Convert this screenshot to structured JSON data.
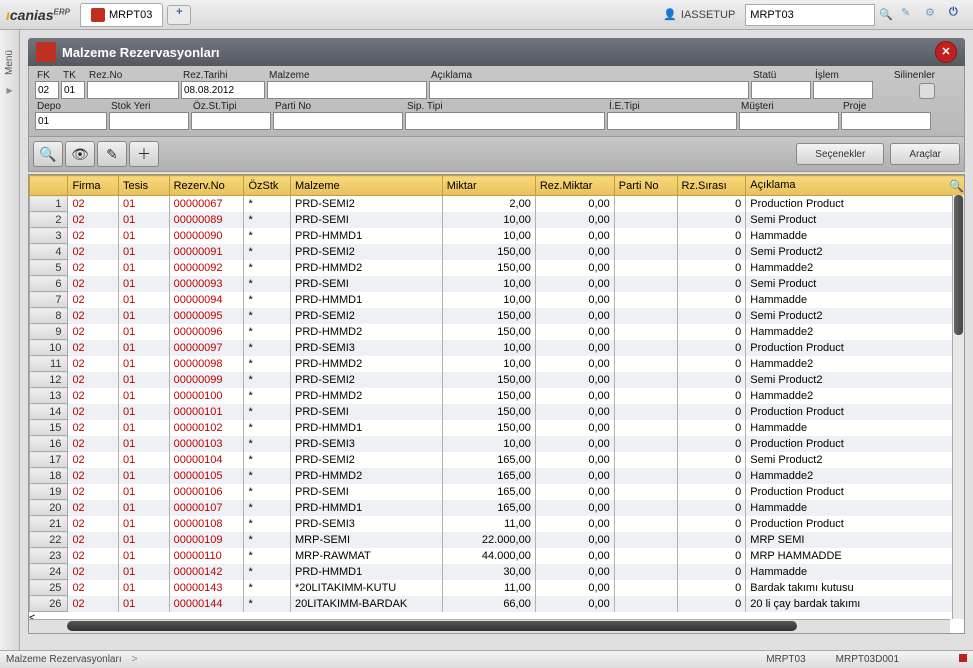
{
  "app": {
    "logo_primary": "canias",
    "logo_suffix": "ERP"
  },
  "topbar": {
    "tab_label": "MRPT03",
    "username": "IASSETUP",
    "search": {
      "value": "MRPT03"
    }
  },
  "sidepanel": {
    "menu": "Menü"
  },
  "window": {
    "title": "Malzeme Rezervasyonları"
  },
  "filters": {
    "row1": {
      "fk": {
        "label": "FK",
        "value": "02"
      },
      "tk": {
        "label": "TK",
        "value": "01"
      },
      "rezno": {
        "label": "Rez.No",
        "value": ""
      },
      "reztarihi": {
        "label": "Rez.Tarihi",
        "value": "08.08.2012"
      },
      "malzeme": {
        "label": "Malzeme",
        "value": ""
      },
      "aciklama": {
        "label": "Açıklama",
        "value": ""
      },
      "statu": {
        "label": "Statü",
        "value": ""
      },
      "islem": {
        "label": "İşlem",
        "value": ""
      },
      "silinenler": {
        "label": "Silinenler"
      }
    },
    "row2": {
      "depo": {
        "label": "Depo",
        "value": "01"
      },
      "stokyeri": {
        "label": "Stok Yeri",
        "value": ""
      },
      "ozsttipi": {
        "label": "Öz.St.Tipi",
        "value": ""
      },
      "partino": {
        "label": "Parti No",
        "value": ""
      },
      "siptipi": {
        "label": "Sip. Tipi",
        "value": ""
      },
      "ietipi": {
        "label": "İ.E.Tipi",
        "value": ""
      },
      "musteri": {
        "label": "Müşteri",
        "value": ""
      },
      "proje": {
        "label": "Proje",
        "value": ""
      }
    }
  },
  "toolbar": {
    "secenekler": "Seçenekler",
    "araclar": "Araçlar"
  },
  "table": {
    "headers": {
      "firma": "Firma",
      "tesis": "Tesis",
      "rezervno": "Rezerv.No",
      "ozstk": "ÖzStk",
      "malzeme": "Malzeme",
      "miktar": "Miktar",
      "rezmiktar": "Rez.Miktar",
      "partino": "Parti No",
      "rzsirasi": "Rz.Sırası",
      "aciklama": "Açıklama"
    },
    "rows": [
      {
        "n": "1",
        "firma": "02",
        "tesis": "01",
        "rez": "00000067",
        "oz": "*",
        "mal": "PRD-SEMI2",
        "mik": "2,00",
        "rm": "0,00",
        "pn": "",
        "rs": "0",
        "ac": "Production Product"
      },
      {
        "n": "2",
        "firma": "02",
        "tesis": "01",
        "rez": "00000089",
        "oz": "*",
        "mal": "PRD-SEMI",
        "mik": "10,00",
        "rm": "0,00",
        "pn": "",
        "rs": "0",
        "ac": "Semi Product"
      },
      {
        "n": "3",
        "firma": "02",
        "tesis": "01",
        "rez": "00000090",
        "oz": "*",
        "mal": "PRD-HMMD1",
        "mik": "10,00",
        "rm": "0,00",
        "pn": "",
        "rs": "0",
        "ac": "Hammadde"
      },
      {
        "n": "4",
        "firma": "02",
        "tesis": "01",
        "rez": "00000091",
        "oz": "*",
        "mal": "PRD-SEMI2",
        "mik": "150,00",
        "rm": "0,00",
        "pn": "",
        "rs": "0",
        "ac": "Semi Product2"
      },
      {
        "n": "5",
        "firma": "02",
        "tesis": "01",
        "rez": "00000092",
        "oz": "*",
        "mal": "PRD-HMMD2",
        "mik": "150,00",
        "rm": "0,00",
        "pn": "",
        "rs": "0",
        "ac": "Hammadde2"
      },
      {
        "n": "6",
        "firma": "02",
        "tesis": "01",
        "rez": "00000093",
        "oz": "*",
        "mal": "PRD-SEMI",
        "mik": "10,00",
        "rm": "0,00",
        "pn": "",
        "rs": "0",
        "ac": "Semi Product"
      },
      {
        "n": "7",
        "firma": "02",
        "tesis": "01",
        "rez": "00000094",
        "oz": "*",
        "mal": "PRD-HMMD1",
        "mik": "10,00",
        "rm": "0,00",
        "pn": "",
        "rs": "0",
        "ac": "Hammadde"
      },
      {
        "n": "8",
        "firma": "02",
        "tesis": "01",
        "rez": "00000095",
        "oz": "*",
        "mal": "PRD-SEMI2",
        "mik": "150,00",
        "rm": "0,00",
        "pn": "",
        "rs": "0",
        "ac": "Semi Product2"
      },
      {
        "n": "9",
        "firma": "02",
        "tesis": "01",
        "rez": "00000096",
        "oz": "*",
        "mal": "PRD-HMMD2",
        "mik": "150,00",
        "rm": "0,00",
        "pn": "",
        "rs": "0",
        "ac": "Hammadde2"
      },
      {
        "n": "10",
        "firma": "02",
        "tesis": "01",
        "rez": "00000097",
        "oz": "*",
        "mal": "PRD-SEMI3",
        "mik": "10,00",
        "rm": "0,00",
        "pn": "",
        "rs": "0",
        "ac": "Production Product"
      },
      {
        "n": "11",
        "firma": "02",
        "tesis": "01",
        "rez": "00000098",
        "oz": "*",
        "mal": "PRD-HMMD2",
        "mik": "10,00",
        "rm": "0,00",
        "pn": "",
        "rs": "0",
        "ac": "Hammadde2"
      },
      {
        "n": "12",
        "firma": "02",
        "tesis": "01",
        "rez": "00000099",
        "oz": "*",
        "mal": "PRD-SEMI2",
        "mik": "150,00",
        "rm": "0,00",
        "pn": "",
        "rs": "0",
        "ac": "Semi Product2"
      },
      {
        "n": "13",
        "firma": "02",
        "tesis": "01",
        "rez": "00000100",
        "oz": "*",
        "mal": "PRD-HMMD2",
        "mik": "150,00",
        "rm": "0,00",
        "pn": "",
        "rs": "0",
        "ac": "Hammadde2"
      },
      {
        "n": "14",
        "firma": "02",
        "tesis": "01",
        "rez": "00000101",
        "oz": "*",
        "mal": "PRD-SEMI",
        "mik": "150,00",
        "rm": "0,00",
        "pn": "",
        "rs": "0",
        "ac": "Production Product"
      },
      {
        "n": "15",
        "firma": "02",
        "tesis": "01",
        "rez": "00000102",
        "oz": "*",
        "mal": "PRD-HMMD1",
        "mik": "150,00",
        "rm": "0,00",
        "pn": "",
        "rs": "0",
        "ac": "Hammadde"
      },
      {
        "n": "16",
        "firma": "02",
        "tesis": "01",
        "rez": "00000103",
        "oz": "*",
        "mal": "PRD-SEMI3",
        "mik": "10,00",
        "rm": "0,00",
        "pn": "",
        "rs": "0",
        "ac": "Production Product"
      },
      {
        "n": "17",
        "firma": "02",
        "tesis": "01",
        "rez": "00000104",
        "oz": "*",
        "mal": "PRD-SEMI2",
        "mik": "165,00",
        "rm": "0,00",
        "pn": "",
        "rs": "0",
        "ac": "Semi Product2"
      },
      {
        "n": "18",
        "firma": "02",
        "tesis": "01",
        "rez": "00000105",
        "oz": "*",
        "mal": "PRD-HMMD2",
        "mik": "165,00",
        "rm": "0,00",
        "pn": "",
        "rs": "0",
        "ac": "Hammadde2"
      },
      {
        "n": "19",
        "firma": "02",
        "tesis": "01",
        "rez": "00000106",
        "oz": "*",
        "mal": "PRD-SEMI",
        "mik": "165,00",
        "rm": "0,00",
        "pn": "",
        "rs": "0",
        "ac": "Production Product"
      },
      {
        "n": "20",
        "firma": "02",
        "tesis": "01",
        "rez": "00000107",
        "oz": "*",
        "mal": "PRD-HMMD1",
        "mik": "165,00",
        "rm": "0,00",
        "pn": "",
        "rs": "0",
        "ac": "Hammadde"
      },
      {
        "n": "21",
        "firma": "02",
        "tesis": "01",
        "rez": "00000108",
        "oz": "*",
        "mal": "PRD-SEMI3",
        "mik": "11,00",
        "rm": "0,00",
        "pn": "",
        "rs": "0",
        "ac": "Production Product"
      },
      {
        "n": "22",
        "firma": "02",
        "tesis": "01",
        "rez": "00000109",
        "oz": "*",
        "mal": "MRP-SEMI",
        "mik": "22.000,00",
        "rm": "0,00",
        "pn": "",
        "rs": "0",
        "ac": "MRP SEMI"
      },
      {
        "n": "23",
        "firma": "02",
        "tesis": "01",
        "rez": "00000110",
        "oz": "*",
        "mal": "MRP-RAWMAT",
        "mik": "44.000,00",
        "rm": "0,00",
        "pn": "",
        "rs": "0",
        "ac": "MRP HAMMADDE"
      },
      {
        "n": "24",
        "firma": "02",
        "tesis": "01",
        "rez": "00000142",
        "oz": "*",
        "mal": "PRD-HMMD1",
        "mik": "30,00",
        "rm": "0,00",
        "pn": "",
        "rs": "0",
        "ac": "Hammadde"
      },
      {
        "n": "25",
        "firma": "02",
        "tesis": "01",
        "rez": "00000143",
        "oz": "*",
        "mal": "*20LITAKIMM-KUTU",
        "mik": "11,00",
        "rm": "0,00",
        "pn": "",
        "rs": "0",
        "ac": "Bardak takımı kutusu"
      },
      {
        "n": "26",
        "firma": "02",
        "tesis": "01",
        "rez": "00000144",
        "oz": "*",
        "mal": "20LITAKIMM-BARDAK",
        "mik": "66,00",
        "rm": "0,00",
        "pn": "",
        "rs": "0",
        "ac": "20 li çay bardak takımı"
      }
    ]
  },
  "statusbar": {
    "left": "Malzeme Rezervasyonları",
    "chevron": ">",
    "code1": "MRPT03",
    "code2": "MRPT03D001"
  }
}
